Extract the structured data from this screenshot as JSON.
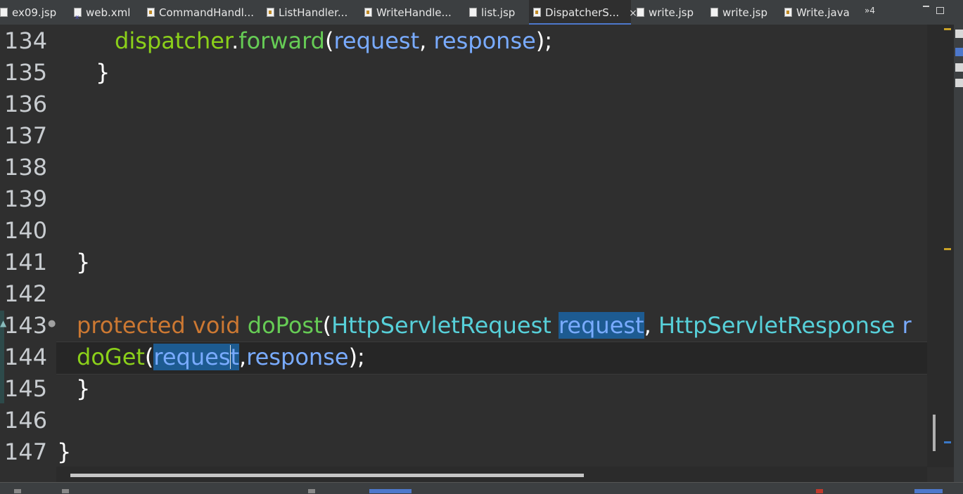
{
  "tabs": [
    {
      "label": "ex09.jsp",
      "icon": "jsp-file-icon",
      "active": false
    },
    {
      "label": "web.xml",
      "icon": "xml-file-icon",
      "active": false
    },
    {
      "label": "CommandHandl...",
      "icon": "java-file-icon",
      "active": false
    },
    {
      "label": "ListHandler...",
      "icon": "java-file-icon",
      "active": false
    },
    {
      "label": "WriteHandle...",
      "icon": "java-file-icon",
      "active": false
    },
    {
      "label": "list.jsp",
      "icon": "jsp-file-icon",
      "active": false
    },
    {
      "label": "DispatcherS...",
      "icon": "java-file-icon",
      "active": true
    },
    {
      "label": "write.jsp",
      "icon": "jsp-file-icon",
      "active": false
    },
    {
      "label": "write.jsp",
      "icon": "jsp-file-icon",
      "active": false
    },
    {
      "label": "Write.java",
      "icon": "java-file-icon",
      "active": false
    }
  ],
  "tab_close": "×",
  "tab_overflow": "»4",
  "line_numbers": [
    "134",
    "135",
    "136",
    "137",
    "138",
    "139",
    "140",
    "141",
    "142",
    "143",
    "144",
    "145",
    "146",
    "147"
  ],
  "code": {
    "l134": {
      "obj": "dispatcher",
      "dot": ".",
      "method": "forward",
      "open": "(",
      "arg1": "request",
      "comma": ", ",
      "arg2": "response",
      "close": ");"
    },
    "l135": "}",
    "l141": "}",
    "l143": {
      "kw1": "protected",
      "kw2": "void",
      "name": "doPost",
      "open": "(",
      "type1": "HttpServletRequest",
      "param1": "request",
      "comma": ", ",
      "type2": "HttpServletResponse",
      "param2": "r"
    },
    "l144": {
      "name": "doGet",
      "open": "(",
      "arg1_a": "reques",
      "arg1_b": "t",
      "comma": ",",
      "arg2": "response",
      "close": ");"
    },
    "l145": "}",
    "l147": "}"
  },
  "colors": {
    "background": "#2f2f2f",
    "keyword": "#cc7832",
    "method": "#8bd01a",
    "variable": "#79abff",
    "type": "#57d0d9",
    "highlight": "#1d5b91"
  }
}
